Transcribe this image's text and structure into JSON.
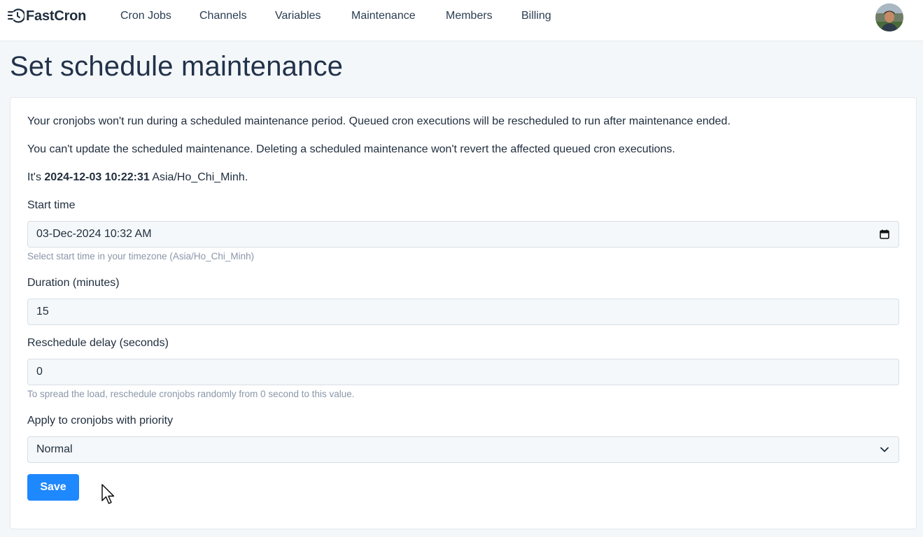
{
  "brand": {
    "name": "FastCron"
  },
  "nav": {
    "items": [
      {
        "label": "Cron Jobs"
      },
      {
        "label": "Channels"
      },
      {
        "label": "Variables"
      },
      {
        "label": "Maintenance"
      },
      {
        "label": "Members"
      },
      {
        "label": "Billing"
      }
    ]
  },
  "page": {
    "title": "Set schedule maintenance"
  },
  "info": {
    "line1": "Your cronjobs won't run during a scheduled maintenance period. Queued cron executions will be rescheduled to run after maintenance ended.",
    "line2": "You can't update the scheduled maintenance. Deleting a scheduled maintenance won't revert the affected queued cron executions.",
    "now_prefix": "It's",
    "now_time": "2024-12-03 10:22:31",
    "now_tz": "Asia/Ho_Chi_Minh."
  },
  "form": {
    "start_time": {
      "label": "Start time",
      "value": "03-Dec-2024 10:32  AM",
      "help": "Select start time in your timezone (Asia/Ho_Chi_Minh)"
    },
    "duration": {
      "label": "Duration (minutes)",
      "value": "15"
    },
    "reschedule_delay": {
      "label": "Reschedule delay (seconds)",
      "value": "0",
      "help": "To spread the load, reschedule cronjobs randomly from 0 second to this value."
    },
    "priority": {
      "label": "Apply to cronjobs with priority",
      "value": "Normal"
    },
    "save_label": "Save"
  },
  "colors": {
    "accent": "#1e88ff",
    "text": "#1f2d3d",
    "muted": "#8a97a8",
    "bg": "#f4f7fa"
  },
  "icons": [
    "clock-history-icon",
    "calendar-icon",
    "chevron-down-icon",
    "avatar",
    "mouse-cursor-icon"
  ]
}
